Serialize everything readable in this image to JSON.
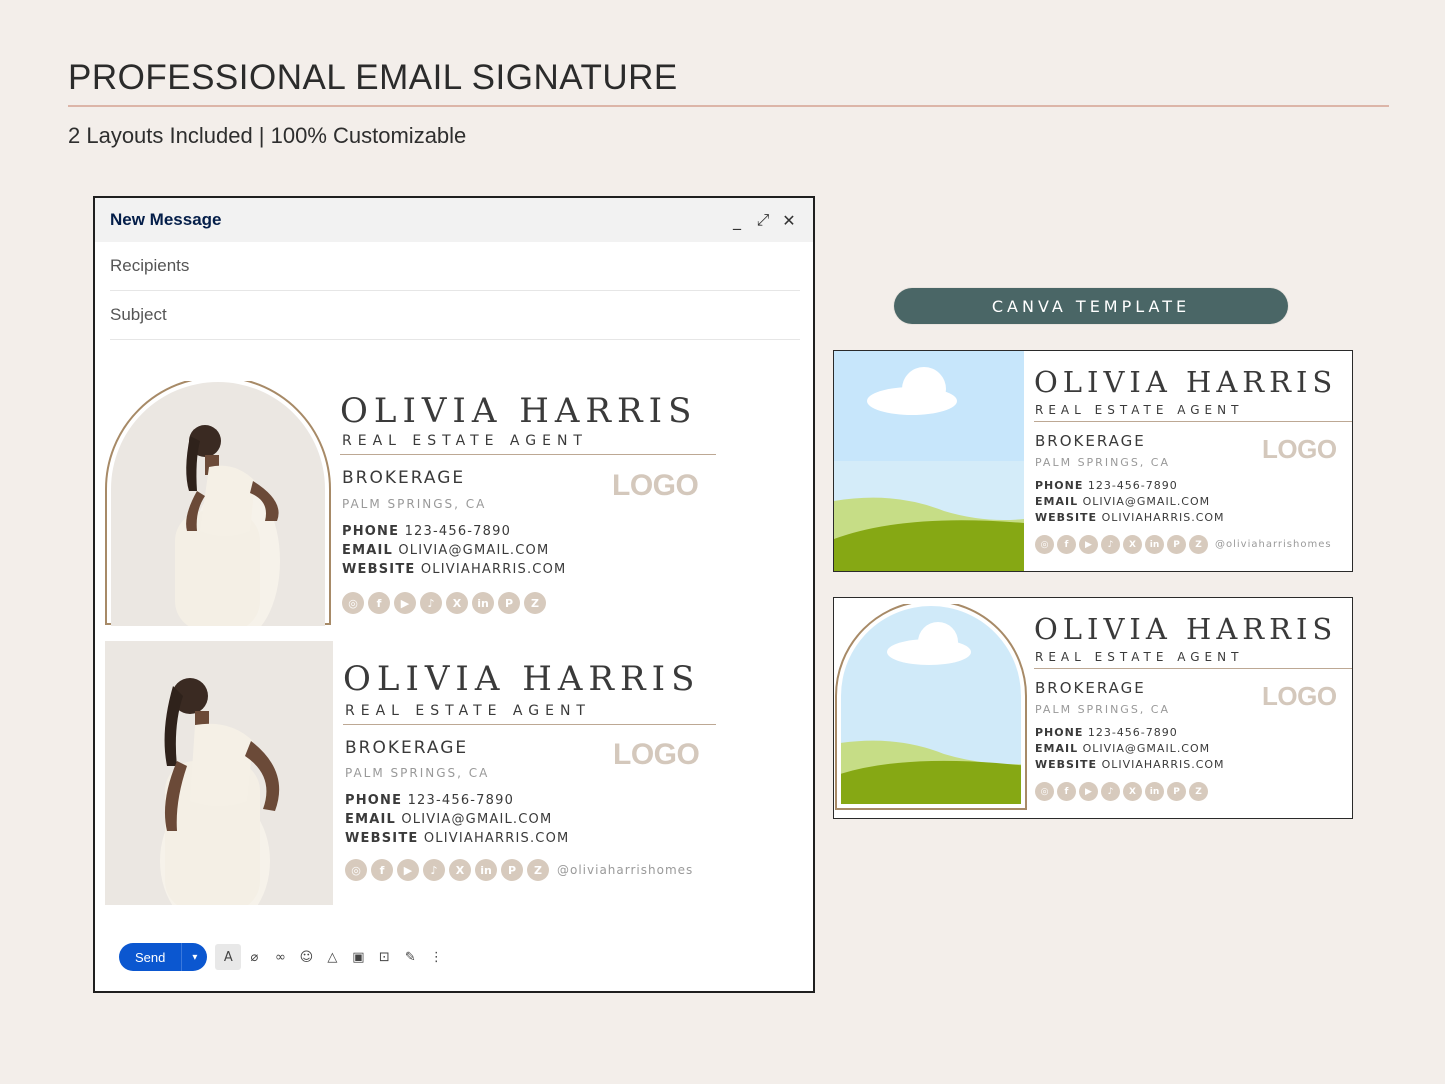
{
  "header": {
    "title": "PROFESSIONAL EMAIL SIGNATURE",
    "subtitle": "2 Layouts Included | 100% Customizable"
  },
  "compose": {
    "title": "New Message",
    "minimize": "_",
    "expand": "⤢",
    "close": "✕",
    "recipients_placeholder": "Recipients",
    "subject_placeholder": "Subject",
    "send_label": "Send",
    "send_more": "▾"
  },
  "signature": {
    "name": "OLIVIA HARRIS",
    "role": "REAL ESTATE AGENT",
    "brokerage": "BROKERAGE",
    "location": "PALM SPRINGS, CA",
    "logo": "LOGO",
    "phone_label": "PHONE",
    "phone": "123-456-7890",
    "email_label": "EMAIL",
    "email": "OLIVIA@GMAIL.COM",
    "website_label": "WEBSITE",
    "website": "OLIVIAHARRIS.COM",
    "handle": "@oliviaharrishomes"
  },
  "socials": [
    {
      "icon": "instagram-icon",
      "glyph": "◎"
    },
    {
      "icon": "facebook-icon",
      "glyph": "f"
    },
    {
      "icon": "youtube-icon",
      "glyph": "▶"
    },
    {
      "icon": "tiktok-icon",
      "glyph": "♪"
    },
    {
      "icon": "x-icon",
      "glyph": "X"
    },
    {
      "icon": "linkedin-icon",
      "glyph": "in"
    },
    {
      "icon": "pinterest-icon",
      "glyph": "P"
    },
    {
      "icon": "zillow-icon",
      "glyph": "Z"
    }
  ],
  "toolbar_icons": [
    {
      "icon": "format-text-icon",
      "glyph": "A"
    },
    {
      "icon": "attach-icon",
      "glyph": "⌀"
    },
    {
      "icon": "link-icon",
      "glyph": "∞"
    },
    {
      "icon": "emoji-icon",
      "glyph": "☺"
    },
    {
      "icon": "drive-icon",
      "glyph": "△"
    },
    {
      "icon": "image-icon",
      "glyph": "▣"
    },
    {
      "icon": "confidential-icon",
      "glyph": "⊡"
    },
    {
      "icon": "signature-pen-icon",
      "glyph": "✎"
    },
    {
      "icon": "more-options-icon",
      "glyph": "⋮"
    }
  ],
  "canva": {
    "button_label": "CANVA TEMPLATE"
  },
  "colors": {
    "background": "#f3eeea",
    "accent_rule": "#dcb5a8",
    "canva_button": "#4a6666",
    "send_button": "#0b57d0",
    "arch_border": "#a78a67",
    "social_icon": "#d7cabd"
  }
}
